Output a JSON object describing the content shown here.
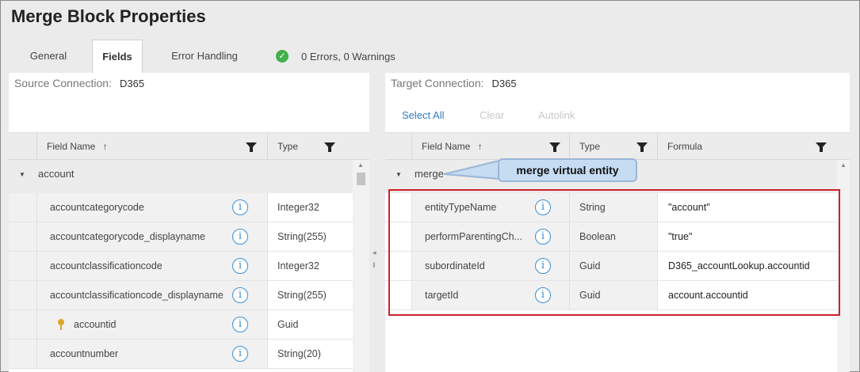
{
  "title": "Merge Block Properties",
  "tabs": [
    {
      "label": "General",
      "active": false
    },
    {
      "label": "Fields",
      "active": true
    },
    {
      "label": "Error Handling",
      "active": false
    }
  ],
  "status": {
    "text": "0 Errors, 0 Warnings",
    "icon": "check-circle-icon",
    "color": "#43b049"
  },
  "source": {
    "label": "Source Connection:",
    "value": "D365",
    "columns": {
      "field": "Field Name",
      "type": "Type"
    },
    "group": "account",
    "rows": [
      {
        "name": "accountcategorycode",
        "type": "Integer32"
      },
      {
        "name": "accountcategorycode_displayname",
        "type": "String(255)"
      },
      {
        "name": "accountclassificationcode",
        "type": "Integer32"
      },
      {
        "name": "accountclassificationcode_displayname",
        "type": "String(255)"
      },
      {
        "name": "accountid",
        "type": "Guid",
        "key": true
      },
      {
        "name": "accountnumber",
        "type": "String(20)"
      }
    ]
  },
  "target": {
    "label": "Target Connection:",
    "value": "D365",
    "links": {
      "select_all": "Select All",
      "clear": "Clear",
      "autolink": "Autolink"
    },
    "columns": {
      "field": "Field Name",
      "type": "Type",
      "formula": "Formula"
    },
    "group": "merge",
    "rows": [
      {
        "name": "entityTypeName",
        "type": "String",
        "formula": "\"account\""
      },
      {
        "name": "performParentingCh...",
        "type": "Boolean",
        "formula": "\"true\""
      },
      {
        "name": "subordinateId",
        "type": "Guid",
        "formula": "D365_accountLookup.accountid"
      },
      {
        "name": "targetId",
        "type": "Guid",
        "formula": "account.accountid"
      }
    ]
  },
  "annotation": {
    "text": "merge virtual entity"
  },
  "colors": {
    "link": "#2f7fc7",
    "highlight_border": "#d0202a",
    "callout_bg": "#c5dcf2"
  }
}
